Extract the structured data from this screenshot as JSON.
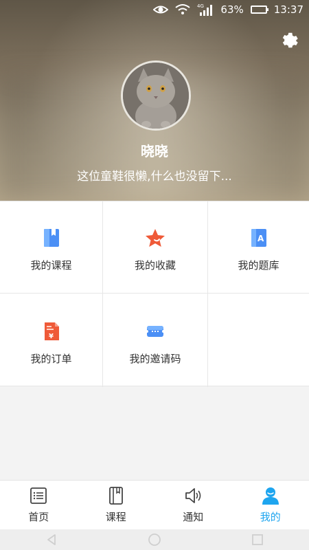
{
  "status_bar": {
    "network": "4G",
    "battery": "63%",
    "battery_level": 0.63,
    "time": "13:37",
    "icons": [
      "eye-icon",
      "wifi-icon",
      "signal-icon",
      "battery-icon"
    ]
  },
  "header": {
    "settings_icon": "gear-icon",
    "username": "晓晓",
    "bio": "这位童鞋很懒,什么也没留下..."
  },
  "menu": {
    "items": [
      {
        "label": "我的课程",
        "icon": "course-book-icon",
        "color": "#3d8bfd"
      },
      {
        "label": "我的收藏",
        "icon": "star-icon",
        "color": "#ef5a38"
      },
      {
        "label": "我的题库",
        "icon": "question-bank-icon",
        "color": "#3d8bfd"
      },
      {
        "label": "我的订单",
        "icon": "order-document-icon",
        "color": "#ef5a38"
      },
      {
        "label": "我的邀请码",
        "icon": "ticket-icon",
        "color": "#3d8bfd"
      }
    ]
  },
  "tabbar": {
    "tabs": [
      {
        "label": "首页",
        "icon": "list-icon"
      },
      {
        "label": "课程",
        "icon": "book-icon"
      },
      {
        "label": "通知",
        "icon": "speaker-icon"
      },
      {
        "label": "我的",
        "icon": "user-icon",
        "active": true
      }
    ],
    "active_color": "#1ea5ef"
  },
  "system_nav": {
    "icons": [
      "back-icon",
      "home-icon",
      "recents-icon"
    ]
  }
}
